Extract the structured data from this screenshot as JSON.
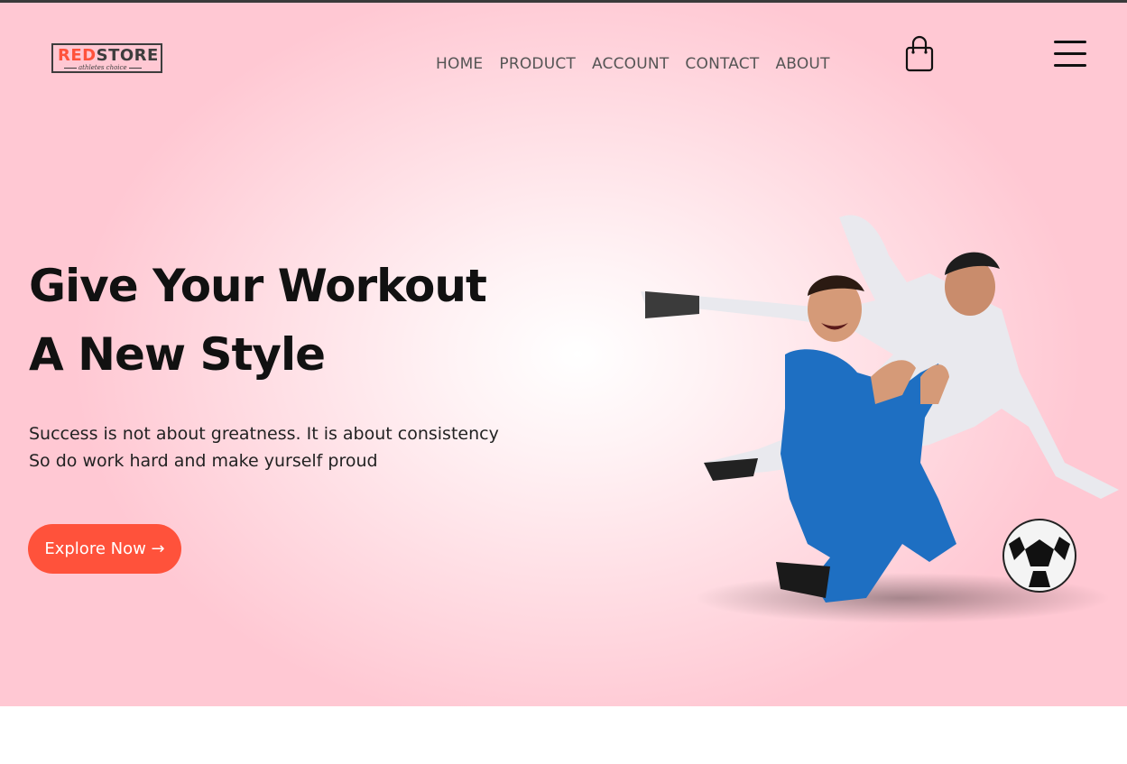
{
  "brand": {
    "logo_part_red": "RED",
    "logo_part_dark": "STORE",
    "logo_subtitle": "athletes choice",
    "accent_color": "#ff523b"
  },
  "nav": {
    "items": [
      {
        "label": "HOME"
      },
      {
        "label": "PRODUCT"
      },
      {
        "label": "ACCOUNT"
      },
      {
        "label": "CONTACT"
      },
      {
        "label": "ABOUT"
      }
    ],
    "cart_icon": "shopping-bag-icon",
    "menu_icon": "hamburger-menu-icon"
  },
  "hero": {
    "headline_line1": "Give Your Workout",
    "headline_line2": "A New Style",
    "tagline_line1": "Success is not about greatness. It is about consistency",
    "tagline_line2": "So do work hard and make yurself proud",
    "cta_label": "Explore Now →",
    "image_subject": "soccer-players-image"
  }
}
